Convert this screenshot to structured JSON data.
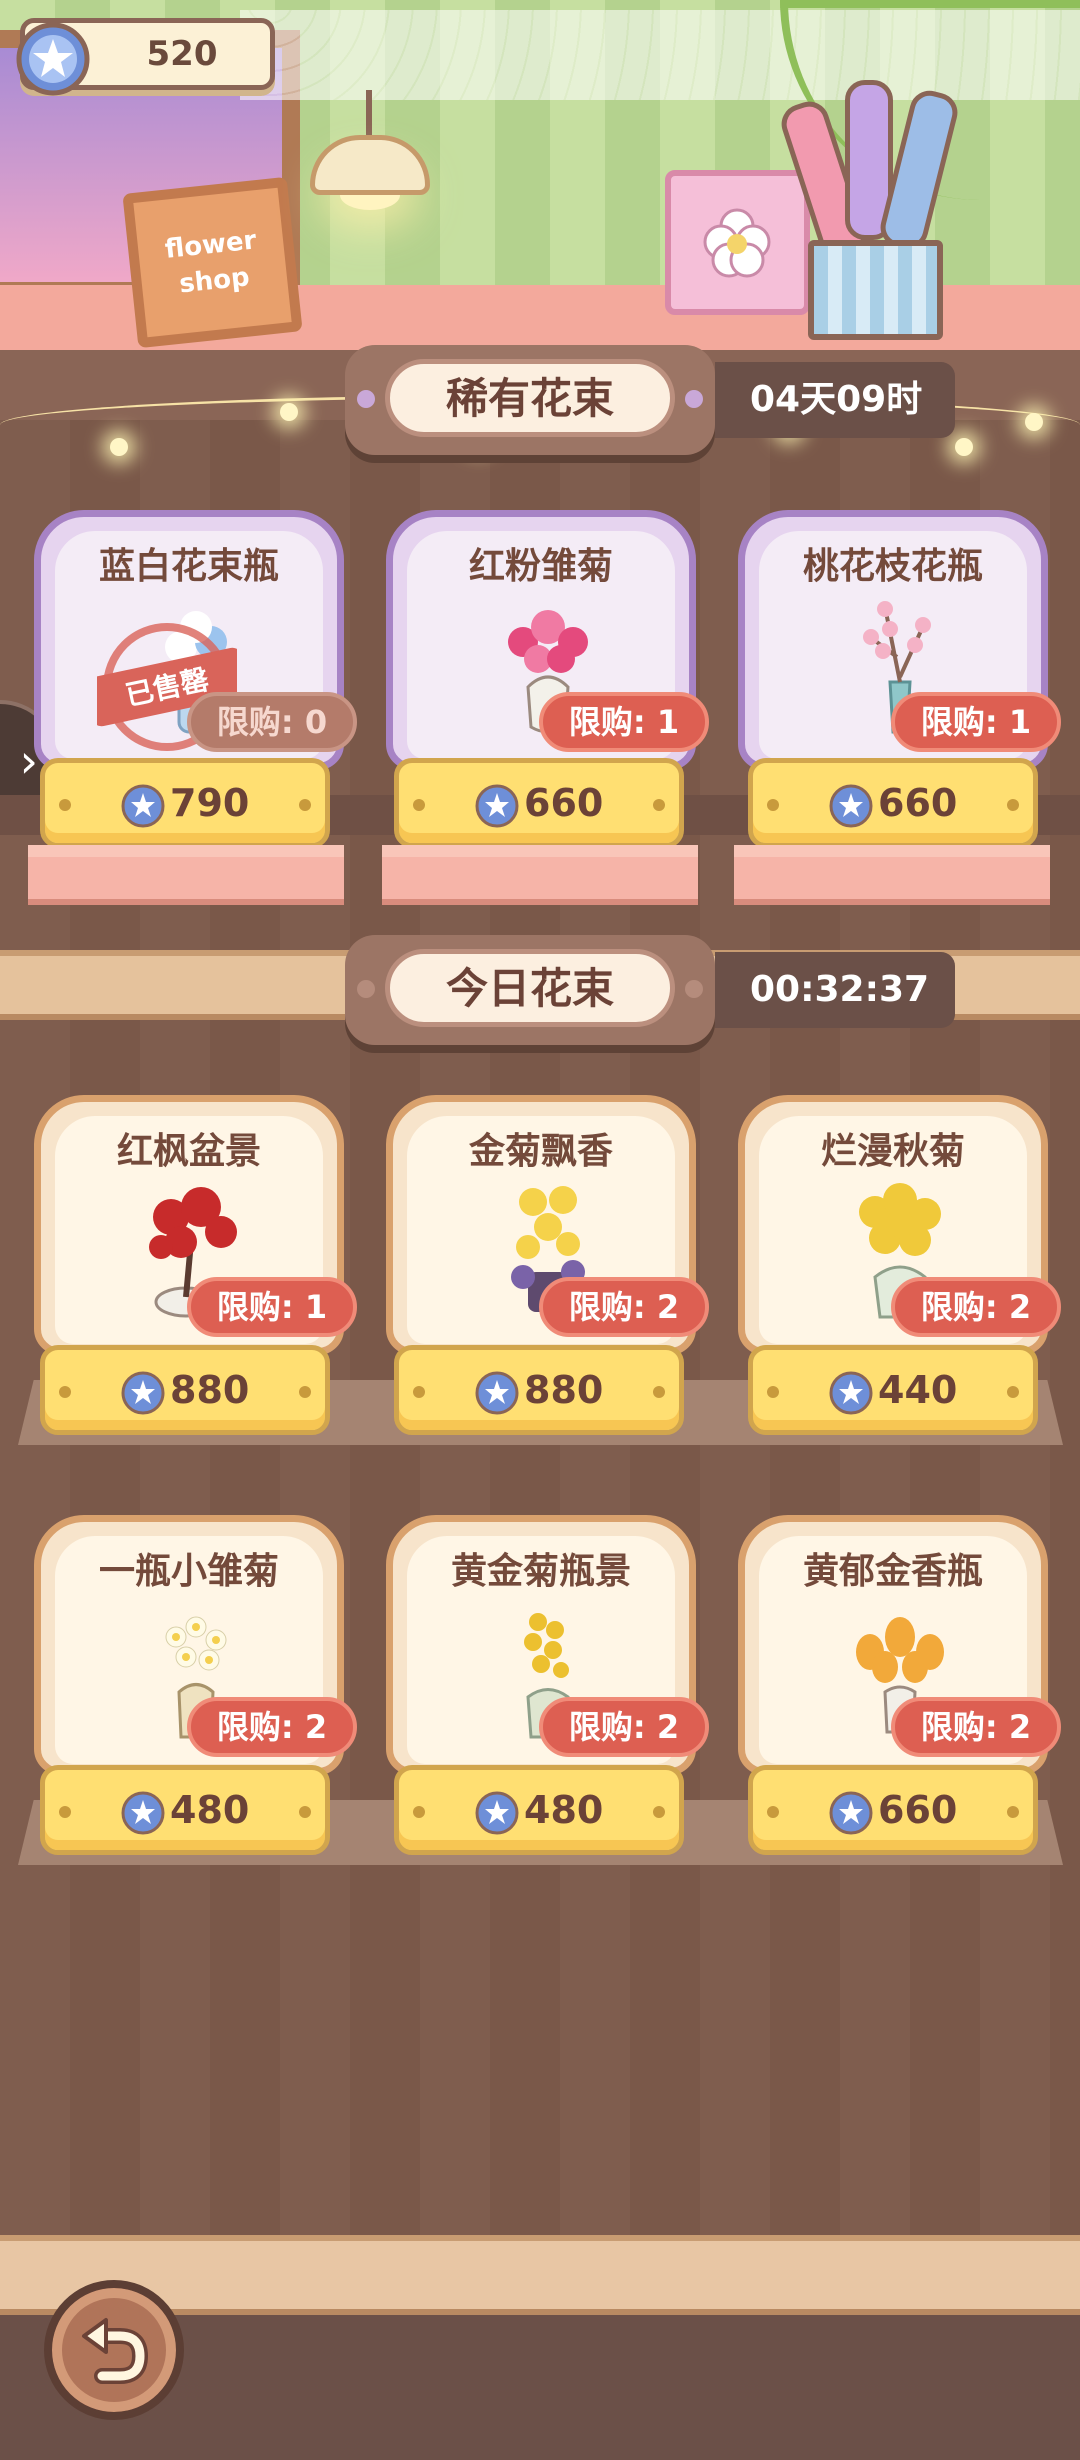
{
  "currency": {
    "amount": "520",
    "icon": "star-gem-icon"
  },
  "side_tab": {
    "glyph": "›"
  },
  "scene": {
    "sign_line1": "flower",
    "sign_line2": "shop"
  },
  "sections": [
    {
      "title": "稀有花束",
      "timer": "04天09时",
      "items": [
        {
          "name": "蓝白花束瓶",
          "limit": "限购: 0",
          "price": "790",
          "sold_out": true,
          "stamp": "已售罄",
          "icon": "blue-white-bouquet-icon"
        },
        {
          "name": "红粉雏菊",
          "limit": "限购: 1",
          "price": "660",
          "sold_out": false,
          "icon": "pink-daisy-vase-icon"
        },
        {
          "name": "桃花枝花瓶",
          "limit": "限购: 1",
          "price": "660",
          "sold_out": false,
          "icon": "peach-branch-vase-icon"
        }
      ]
    },
    {
      "title": "今日花束",
      "timer": "00:32:37",
      "items": [
        {
          "name": "红枫盆景",
          "limit": "限购: 1",
          "price": "880",
          "icon": "red-maple-bonsai-icon"
        },
        {
          "name": "金菊飘香",
          "limit": "限购: 2",
          "price": "880",
          "icon": "golden-chrysanthemum-icon"
        },
        {
          "name": "烂漫秋菊",
          "limit": "限购: 2",
          "price": "440",
          "icon": "autumn-chrysanthemum-icon"
        },
        {
          "name": "一瓶小雏菊",
          "limit": "限购: 2",
          "price": "480",
          "icon": "small-daisy-vase-icon"
        },
        {
          "name": "黄金菊瓶景",
          "limit": "限购: 2",
          "price": "480",
          "icon": "golden-daisy-vase-icon"
        },
        {
          "name": "黄郁金香瓶",
          "limit": "限购: 2",
          "price": "660",
          "icon": "yellow-tulip-vase-icon"
        }
      ]
    }
  ],
  "colors": {
    "limit_badge": "#dd5f52",
    "price_bg": "#ffdf72",
    "rare_card": "#a783c5",
    "daily_card": "#d9a16d"
  }
}
